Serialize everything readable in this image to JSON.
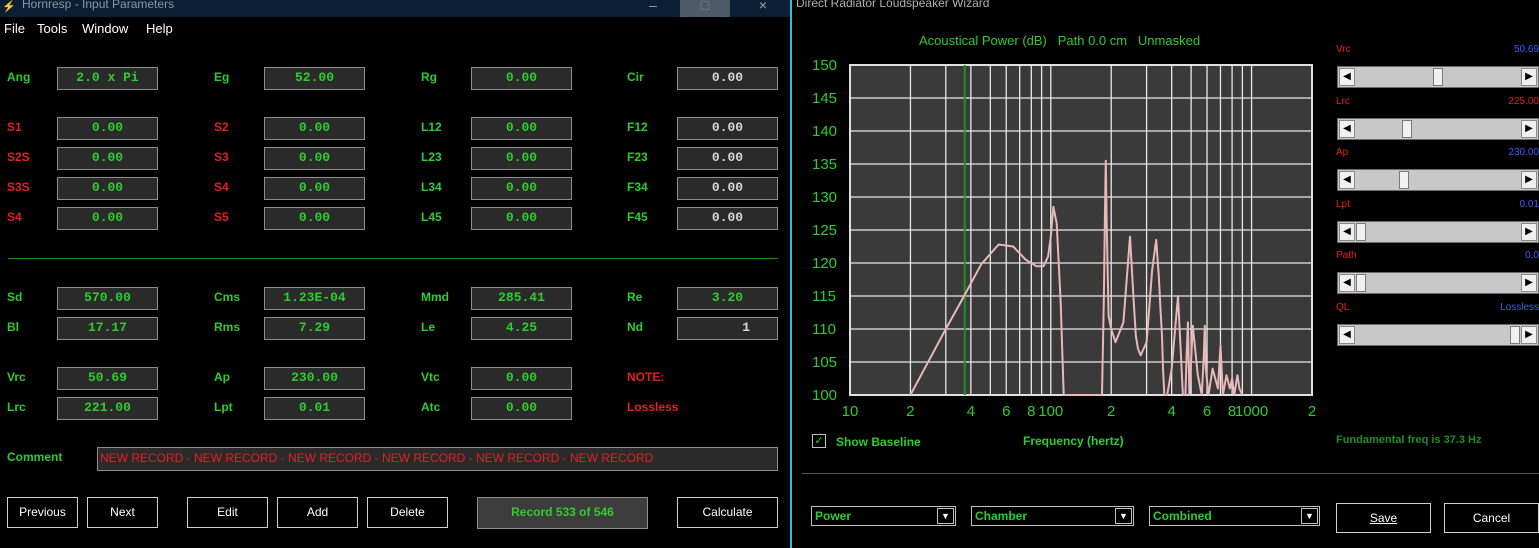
{
  "left_window": {
    "title": "Hornresp - Input Parameters",
    "menu": [
      "File",
      "Tools",
      "Window",
      "Help"
    ],
    "params": {
      "ang": {
        "label": "Ang",
        "value": "2.0 x Pi"
      },
      "eg": {
        "label": "Eg",
        "value": "52.00"
      },
      "rg": {
        "label": "Rg",
        "value": "0.00"
      },
      "cir": {
        "label": "Cir",
        "value": "0.00"
      },
      "s1": {
        "label": "S1",
        "value": "0.00"
      },
      "s2": {
        "label": "S2",
        "value": "0.00"
      },
      "l12": {
        "label": "L12",
        "value": "0.00"
      },
      "f12": {
        "label": "F12",
        "value": "0.00"
      },
      "s2s": {
        "label": "S2S",
        "value": "0.00"
      },
      "s3": {
        "label": "S3",
        "value": "0.00"
      },
      "l23": {
        "label": "L23",
        "value": "0.00"
      },
      "f23": {
        "label": "F23",
        "value": "0.00"
      },
      "s3s": {
        "label": "S3S",
        "value": "0.00"
      },
      "s4": {
        "label": "S4",
        "value": "0.00"
      },
      "l34": {
        "label": "L34",
        "value": "0.00"
      },
      "f34": {
        "label": "F34",
        "value": "0.00"
      },
      "s4b": {
        "label": "S4",
        "value": "0.00"
      },
      "s5": {
        "label": "S5",
        "value": "0.00"
      },
      "l45": {
        "label": "L45",
        "value": "0.00"
      },
      "f45": {
        "label": "F45",
        "value": "0.00"
      },
      "sd": {
        "label": "Sd",
        "value": "570.00"
      },
      "cms": {
        "label": "Cms",
        "value": "1.23E-04"
      },
      "mmd": {
        "label": "Mmd",
        "value": "285.41"
      },
      "re": {
        "label": "Re",
        "value": "3.20"
      },
      "bl": {
        "label": "Bl",
        "value": "17.17"
      },
      "rms": {
        "label": "Rms",
        "value": "7.29"
      },
      "le": {
        "label": "Le",
        "value": "4.25"
      },
      "nd": {
        "label": "Nd",
        "value": "1"
      },
      "vrc": {
        "label": "Vrc",
        "value": "50.69"
      },
      "ap": {
        "label": "Ap",
        "value": "230.00"
      },
      "vtc": {
        "label": "Vtc",
        "value": "0.00"
      },
      "lrc": {
        "label": "Lrc",
        "value": "221.00"
      },
      "lpt": {
        "label": "Lpt",
        "value": "0.01"
      },
      "atc": {
        "label": "Atc",
        "value": "0.00"
      }
    },
    "note_label": "NOTE:",
    "note_value": "Lossless",
    "comment_label": "Comment",
    "comment_value": "NEW RECORD - NEW RECORD - NEW RECORD - NEW RECORD - NEW RECORD - NEW RECORD",
    "buttons": {
      "previous": "Previous",
      "next": "Next",
      "edit": "Edit",
      "add": "Add",
      "delete": "Delete",
      "calculate": "Calculate"
    },
    "record": "Record 533 of 546"
  },
  "right_window": {
    "title": "Direct Radiator Loudspeaker Wizard",
    "chart_title": "Acoustical Power (dB)   Path 0.0 cm   Unmasked",
    "sliders": [
      {
        "label": "Vrc",
        "value": "50.69",
        "position": 0.5
      },
      {
        "label": "Lrc",
        "value": "225.00",
        "position": 0.3
      },
      {
        "label": "Ap",
        "value": "230.00",
        "position": 0.28
      },
      {
        "label": "Lpt",
        "value": "0.01",
        "position": 0.0
      },
      {
        "label": "Path",
        "value": "0.0",
        "position": 0.0
      },
      {
        "label": "QL",
        "value": "Lossless",
        "position": 1.0
      }
    ],
    "show_baseline_label": "Show Baseline",
    "show_baseline_checked": true,
    "frequency_label": "Frequency (hertz)",
    "fundamental_label": "Fundamental freq is 37.3 Hz",
    "combos": {
      "power": "Power",
      "chamber": "Chamber",
      "combined": "Combined"
    },
    "buttons": {
      "save": "Save",
      "cancel": "Cancel"
    }
  },
  "chart_data": {
    "type": "line",
    "title": "Acoustical Power (dB)   Path 0.0 cm   Unmasked",
    "xlabel": "Frequency (hertz)",
    "ylabel": "",
    "x_scale": "log",
    "xlim": [
      10,
      2000
    ],
    "ylim": [
      100,
      150
    ],
    "x_tick_labels": [
      "10",
      "2",
      "4",
      "6",
      "8",
      "100",
      "2",
      "4",
      "6",
      "8",
      "1000",
      "2"
    ],
    "y_tick_labels": [
      "150",
      "145",
      "140",
      "135",
      "130",
      "125",
      "120",
      "115",
      "110",
      "105",
      "100"
    ],
    "fundamental_marker_hz": 37.3,
    "grid": true,
    "series": [
      {
        "color": "#e8b8b8",
        "x": [
          20,
          25,
          30,
          37,
          45,
          55,
          65,
          75,
          85,
          92,
          97,
          100,
          103,
          107,
          112,
          116,
          120,
          180,
          184,
          186,
          188,
          190,
          194,
          200,
          210,
          230,
          248,
          258,
          265,
          272,
          280,
          300,
          320,
          335,
          345,
          352,
          358,
          362,
          368,
          380,
          400,
          430,
          455,
          468,
          475,
          482,
          490,
          510,
          540,
          565,
          578,
          585,
          592,
          610,
          640,
          680,
          700,
          720,
          750,
          780,
          800,
          820,
          850,
          870,
          900
        ],
        "y": [
          100,
          105.5,
          110,
          115,
          119.8,
          122.8,
          122.5,
          120.5,
          119.5,
          119.5,
          121,
          124,
          128.5,
          126,
          114,
          100,
          100,
          100,
          115,
          127,
          135.5,
          126,
          112,
          110,
          108,
          111,
          124,
          115,
          109,
          107,
          106,
          108,
          119,
          123.5,
          118,
          113,
          109,
          104,
          100,
          100,
          104,
          115,
          100,
          100,
          106,
          111,
          100,
          110.5,
          103,
          100,
          106,
          110.5,
          104,
          100,
          104,
          101,
          107.5,
          100,
          103,
          101,
          102.5,
          100,
          103,
          101,
          100
        ]
      }
    ]
  }
}
